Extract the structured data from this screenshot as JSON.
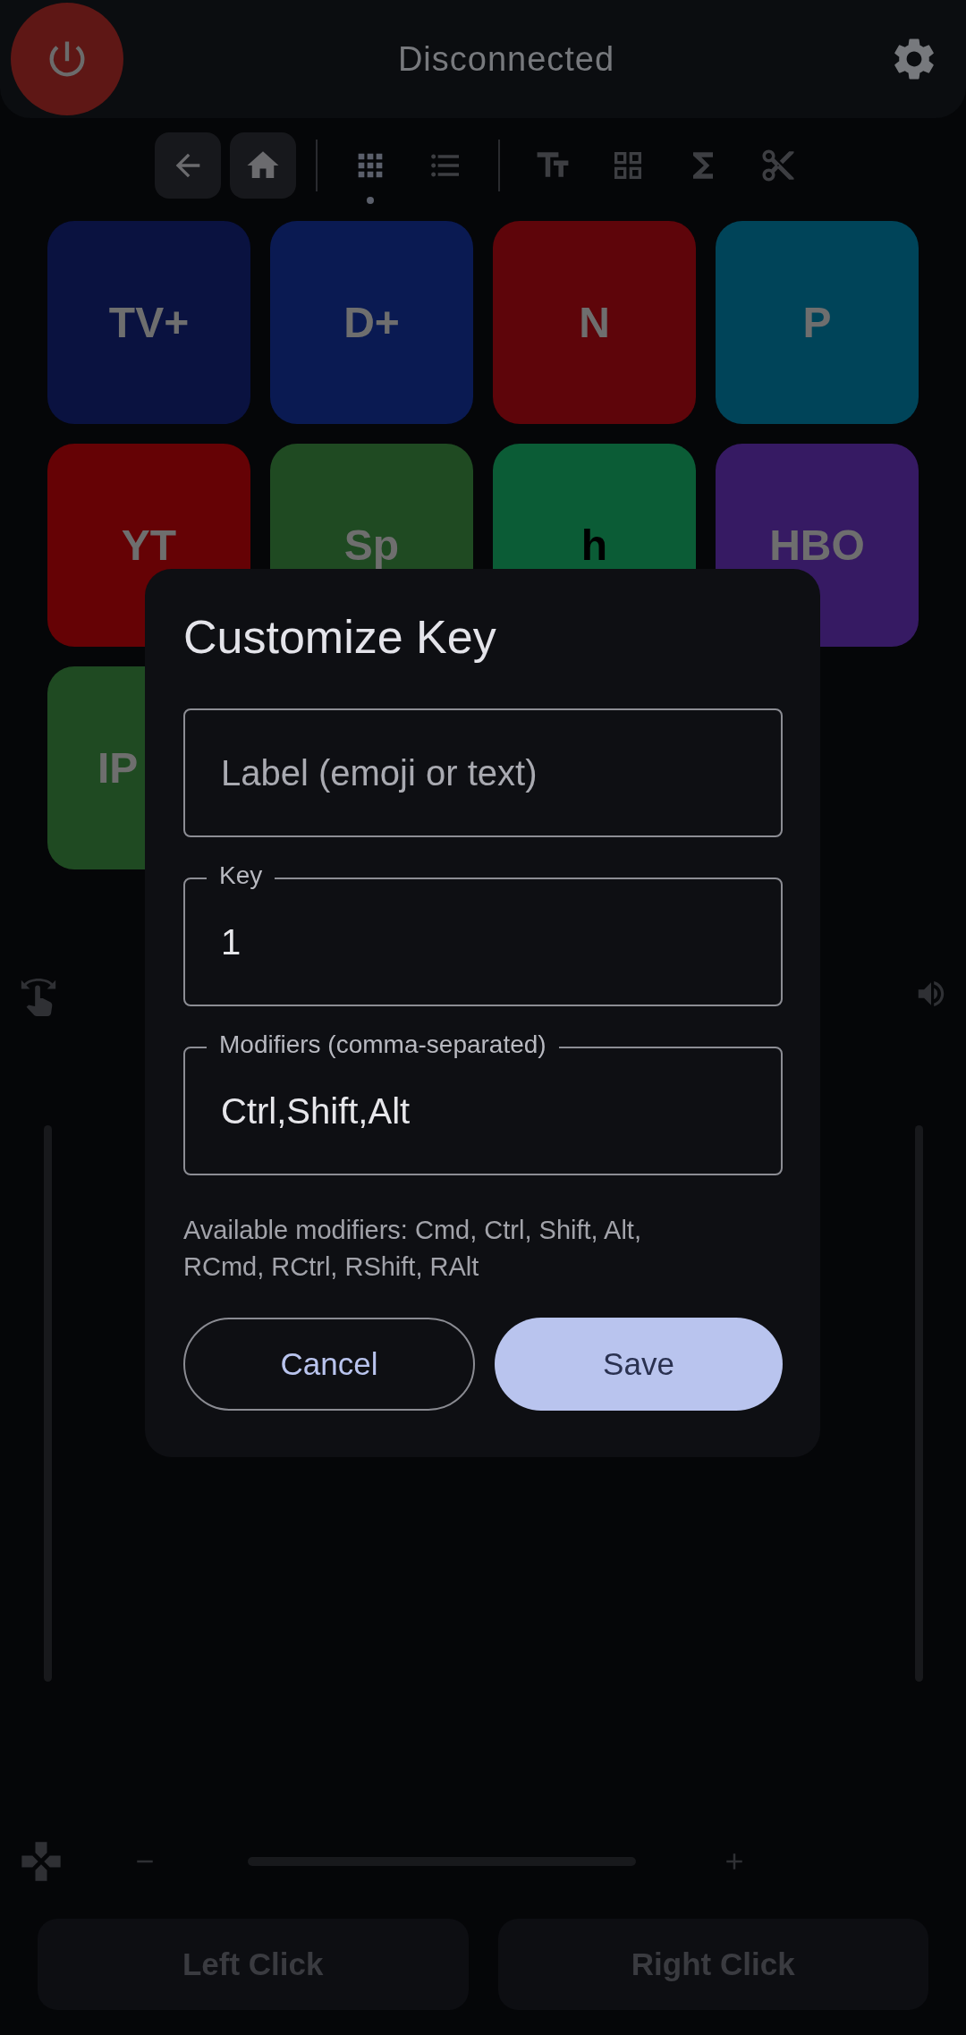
{
  "header": {
    "status": "Disconnected"
  },
  "toolbar": {
    "modes": [
      {
        "kind": "grid",
        "selected": true
      },
      {
        "kind": "list",
        "selected": false
      }
    ]
  },
  "tiles": [
    {
      "label": "TV+",
      "color": "#0a1240",
      "dark_label": false,
      "cut": false
    },
    {
      "label": "D+",
      "color": "#0a1a52",
      "dark_label": false,
      "cut": false
    },
    {
      "label": "N",
      "color": "#5e050a",
      "dark_label": false,
      "cut": false
    },
    {
      "label": "P",
      "color": "#004459",
      "dark_label": false,
      "cut": false
    },
    {
      "label": "YT",
      "color": "#650205",
      "dark_label": false,
      "cut": false
    },
    {
      "label": "Sp",
      "color": "#1f4a22",
      "dark_label": false,
      "cut": false
    },
    {
      "label": "h",
      "color": "#0b5c36",
      "dark_label": true,
      "cut": false
    },
    {
      "label": "HBO",
      "color": "#361a63",
      "dark_label": false,
      "cut": false
    },
    {
      "label": "IP",
      "color": "#1f4a22",
      "dark_label": false,
      "cut": true
    }
  ],
  "dialog": {
    "title": "Customize Key",
    "fields": [
      {
        "placeholder": "Label (emoji or text)"
      },
      {
        "label": "Key",
        "value": "1"
      },
      {
        "label": "Modifiers (comma-separated)",
        "value": "Ctrl,Shift,Alt"
      }
    ],
    "helper": "Available modifiers: Cmd, Ctrl, Shift, Alt, RCmd, RCtrl, RShift, RAlt",
    "buttons": [
      {
        "label": "Cancel",
        "kind": "outlined"
      },
      {
        "label": "Save",
        "kind": "filled"
      }
    ]
  },
  "bottom_buttons": [
    "Left Click",
    "Right Click"
  ]
}
